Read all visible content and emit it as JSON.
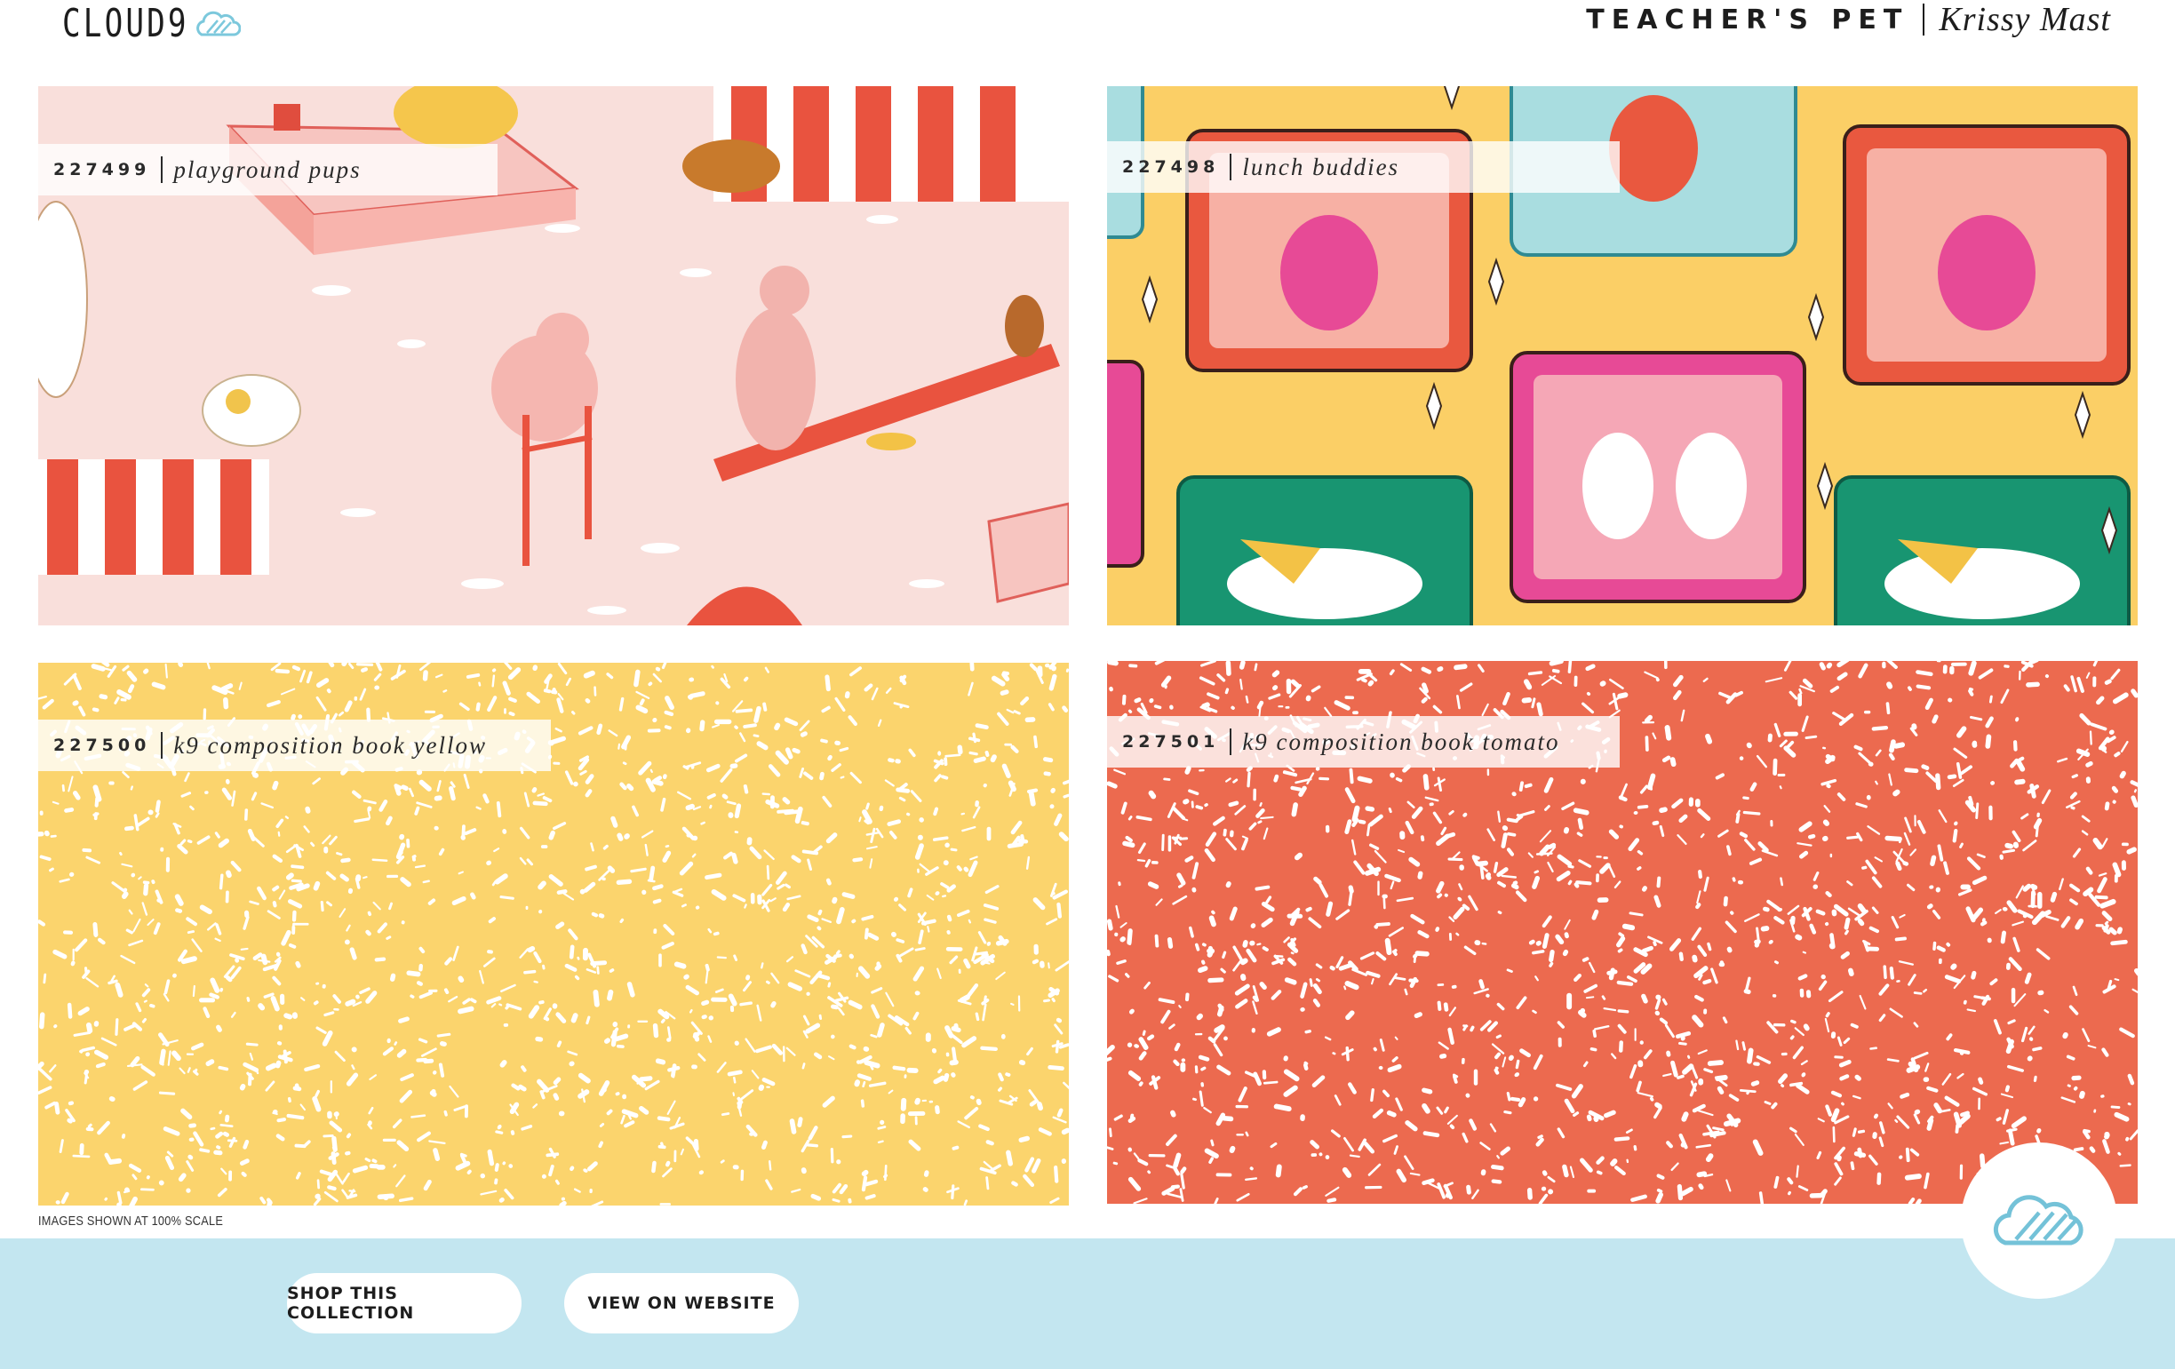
{
  "header": {
    "brand": "CLOUD9",
    "brand_icon": "cloud-icon",
    "collection": "TEACHER'S PET",
    "designer": "Krissy Mast"
  },
  "swatches": [
    {
      "sku": "227499",
      "name": "playground pups",
      "color": "#f9dfdb"
    },
    {
      "sku": "227498",
      "name": "lunch buddies",
      "color": "#fbcf66"
    },
    {
      "sku": "227500",
      "name": "k9 composition book yellow",
      "color": "#fbd46d"
    },
    {
      "sku": "227501",
      "name": "k9 composition book tomato",
      "color": "#ec6a4f"
    }
  ],
  "scale_note": "IMAGES SHOWN AT 100% SCALE",
  "footer": {
    "shop_label": "SHOP THIS COLLECTION",
    "view_label": "VIEW ON WEBSITE",
    "badge_icon": "cloud-icon",
    "background": "#c3e6f0"
  }
}
